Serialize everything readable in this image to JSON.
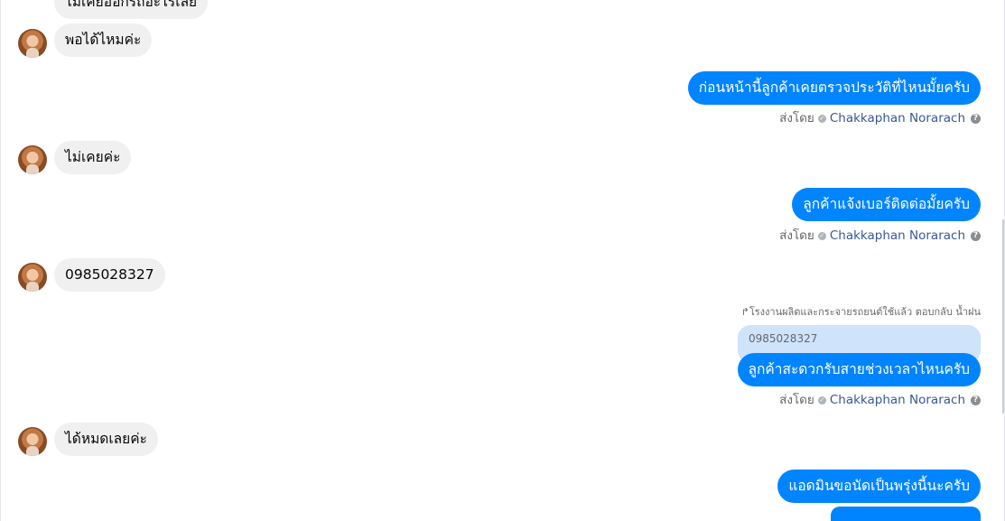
{
  "conversation": {
    "messages_in": [
      {
        "text": "ไม่เคยออกรถอะไรเลย"
      },
      {
        "text": "พอได้ไหมค่ะ"
      },
      {
        "text": "ไม่เคยค่ะ"
      },
      {
        "text": "0985028327"
      },
      {
        "text": "ได้หมดเลยค่ะ"
      }
    ],
    "messages_out": [
      {
        "text": "ก่อนหน้านี้ลูกค้าเคยตรวจประวัติที่ไหนมั้ยครับ"
      },
      {
        "text": "ลูกค้าแจ้งเบอร์ติดต่อมั้ยครับ"
      },
      {
        "text": "ลูกค้าสะดวกรับสายช่วงเวลาไหนครับ"
      },
      {
        "text": "แอดมินขอนัดเป็นพรุ่งนี้นะครับ"
      }
    ],
    "sent_by_label": "ส่งโดย",
    "sender_name": "Chakkaphan Norarach",
    "help_glyph": "?",
    "check_glyph": "✓",
    "reply_note": "โรงงานผลิตและกระจายรถยนต์ใช้แล้ว ตอบกลับ น้ำฝน",
    "reply_arrow": "↱",
    "quoted_text": "0985028327"
  },
  "colors": {
    "outgoing_bubble": "#0084ff",
    "incoming_bubble": "#f0f0f0",
    "quoted_bubble": "#cfe3fb",
    "sender_name": "#385898"
  }
}
